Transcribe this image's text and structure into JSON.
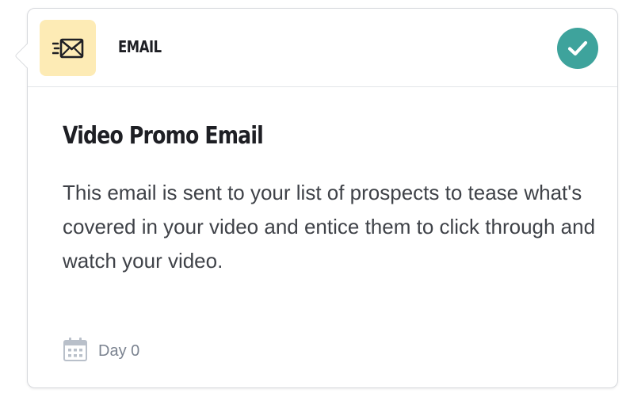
{
  "card": {
    "type_label": "EMAIL",
    "type_icon": "envelope-fast-icon",
    "status_icon": "check-circle-icon",
    "title": "Video Promo Email",
    "description": "This email is sent to your list of prospects to tease what's covered in your video and entice them to click through and watch your video.",
    "schedule_icon": "calendar-icon",
    "schedule_label": "Day 0"
  },
  "colors": {
    "icon_background": "#fdebb5",
    "status_check": "#3ea39c",
    "title_text": "#1e1f24",
    "body_text": "#3f4248",
    "muted_text": "#7b8390"
  }
}
